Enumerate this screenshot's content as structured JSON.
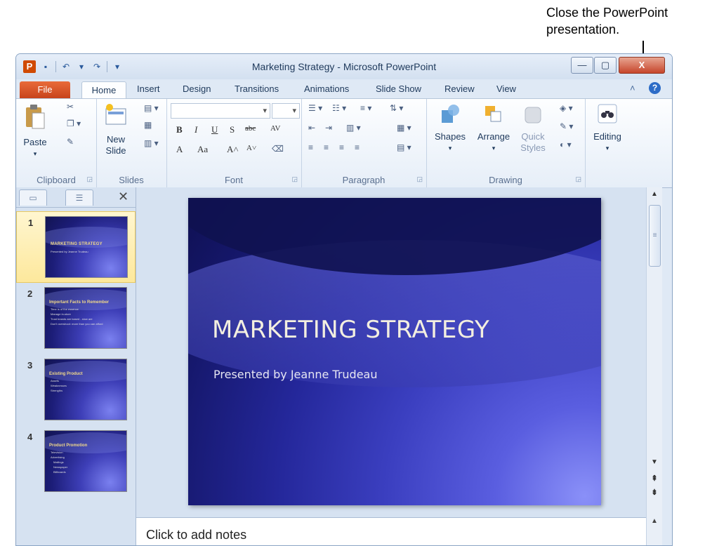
{
  "callout": {
    "line1": "Close the PowerPoint",
    "line2": "presentation."
  },
  "window": {
    "title": "Marketing Strategy - Microsoft PowerPoint"
  },
  "title_controls": {
    "minimize": "—",
    "maximize": "▢",
    "close": "X"
  },
  "tabs": {
    "file": "File",
    "home": "Home",
    "insert": "Insert",
    "design": "Design",
    "transitions": "Transitions",
    "animations": "Animations",
    "slideshow": "Slide Show",
    "review": "Review",
    "view": "View"
  },
  "ribbon": {
    "groups": {
      "clipboard": "Clipboard",
      "slides": "Slides",
      "font": "Font",
      "paragraph": "Paragraph",
      "drawing": "Drawing"
    },
    "paste": "Paste",
    "new_slide_1": "New",
    "new_slide_2": "Slide",
    "shapes": "Shapes",
    "arrange": "Arrange",
    "quick_styles_1": "Quick",
    "quick_styles_2": "Styles",
    "editing": "Editing",
    "font_buttons": {
      "bold": "B",
      "italic": "I",
      "underline": "U",
      "shadow": "S",
      "strike": "abc",
      "spacing": "AV",
      "font_color": "A",
      "case": "Aa",
      "grow": "A˄",
      "shrink": "A˅"
    }
  },
  "slides_panel": {
    "slides": [
      {
        "num": "1",
        "title": "MARKETING STRATEGY",
        "sub": "Presented by Jeanne Trudeau"
      },
      {
        "num": "2",
        "title": "Important Facts to Remember",
        "bullets": [
          "Time is of the essence",
          "Manage in-store",
          "Trust brands are based - slow are",
          "Don't overshoot: more than you can afford"
        ]
      },
      {
        "num": "3",
        "title": "Existing Product",
        "bullets": [
          "Assets",
          "Weaknesses",
          "Strengths"
        ]
      },
      {
        "num": "4",
        "title": "Product Promotion",
        "bullets": [
          "Television",
          "Advertising",
          "Mailings",
          "Newspaper",
          "Billboards"
        ]
      }
    ]
  },
  "slide": {
    "title": "MARKETING STRATEGY",
    "subtitle": "Presented by Jeanne Trudeau"
  },
  "notes": {
    "placeholder": "Click to add notes"
  }
}
